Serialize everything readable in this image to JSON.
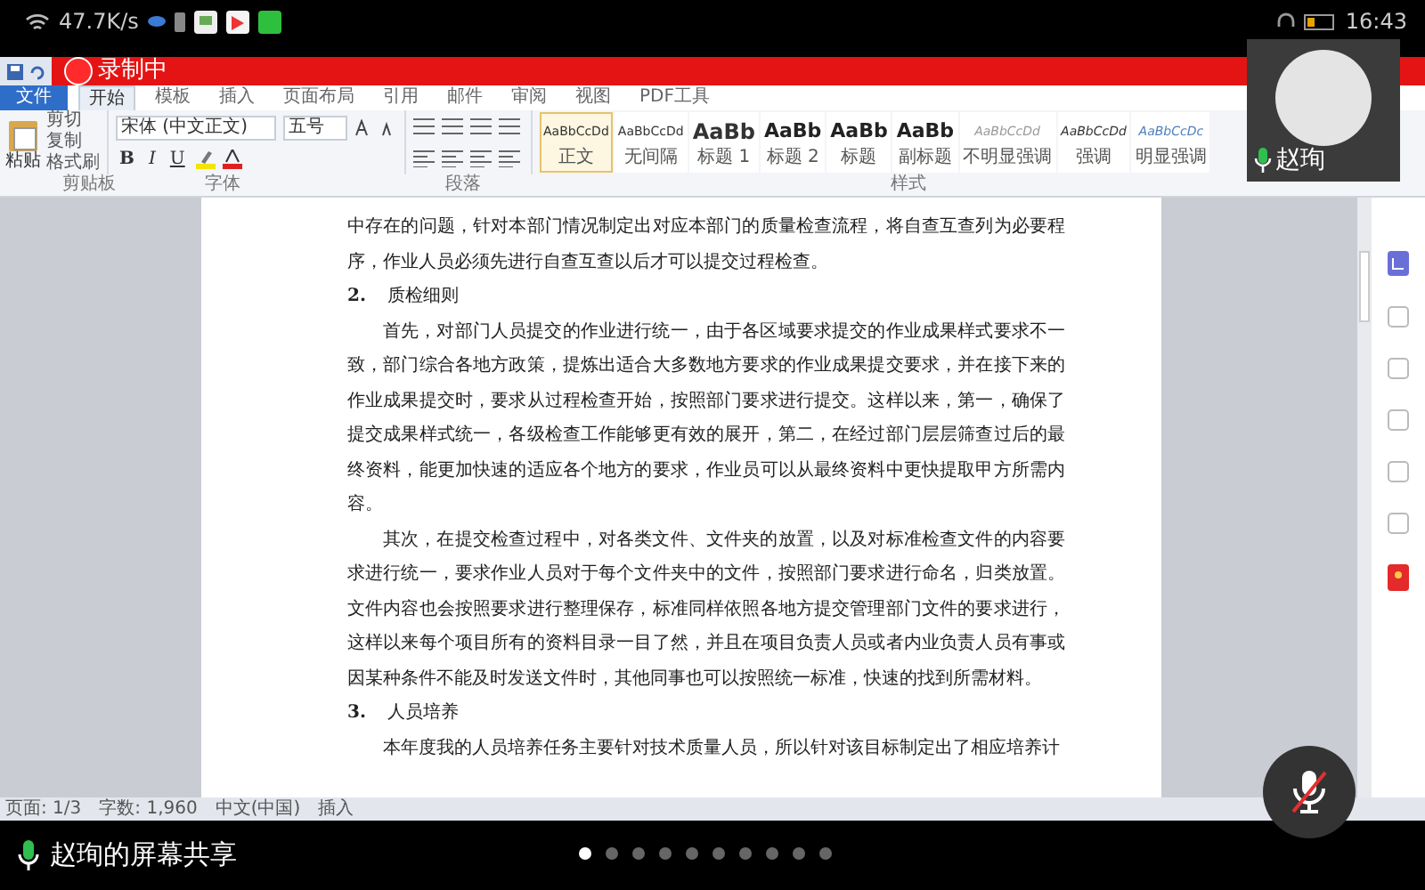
{
  "phone_status": {
    "net_speed": "47.7K/s",
    "time": "16:43"
  },
  "recording": {
    "label": "录制中"
  },
  "ribbon": {
    "tabs": [
      {
        "label": "文件",
        "kind": "file",
        "selected": false
      },
      {
        "label": "开始",
        "kind": "tab",
        "selected": true
      },
      {
        "label": "模板",
        "kind": "tab",
        "selected": false
      },
      {
        "label": "插入",
        "kind": "tab",
        "selected": false
      },
      {
        "label": "页面布局",
        "kind": "tab",
        "selected": false
      },
      {
        "label": "引用",
        "kind": "tab",
        "selected": false
      },
      {
        "label": "邮件",
        "kind": "tab",
        "selected": false
      },
      {
        "label": "审阅",
        "kind": "tab",
        "selected": false
      },
      {
        "label": "视图",
        "kind": "tab",
        "selected": false
      },
      {
        "label": "PDF工具",
        "kind": "tab",
        "selected": false
      }
    ],
    "clipboard": {
      "paste": "粘贴",
      "cut": "剪切",
      "copy": "复制",
      "format_painter": "格式刷"
    },
    "font": {
      "name": "宋体 (中文正文)",
      "size": "五号",
      "bold": "B",
      "italic": "I",
      "underline": "U"
    },
    "styles": [
      {
        "preview": "AaBbCcDd",
        "label": "正文",
        "kind": "small",
        "selected": true
      },
      {
        "preview": "AaBbCcDd",
        "label": "无间隔",
        "kind": "small",
        "selected": false
      },
      {
        "preview": "AaBb",
        "label": "标题 1",
        "kind": "large",
        "selected": false
      },
      {
        "preview": "AaBb",
        "label": "标题 2",
        "kind": "medium",
        "selected": false
      },
      {
        "preview": "AaBb",
        "label": "标题",
        "kind": "medium",
        "selected": false
      },
      {
        "preview": "AaBb",
        "label": "副标题",
        "kind": "medium",
        "selected": false
      },
      {
        "preview": "AaBbCcDd",
        "label": "不明显强调",
        "kind": "faint",
        "selected": false
      },
      {
        "preview": "AaBbCcDd",
        "label": "强调",
        "kind": "italic",
        "selected": false
      },
      {
        "preview": "AaBbCcDc",
        "label": "明显强调",
        "kind": "accent",
        "selected": false
      }
    ],
    "groups": [
      "剪贴板",
      "字体",
      "段落",
      "样式"
    ]
  },
  "document": {
    "paragraphs": [
      {
        "kind": "body",
        "indent": false,
        "text": "中存在的问题，针对本部门情况制定出对应本部门的质量检查流程，将自查互查列为必要程序，作业人员必须先进行自查互查以后才可以提交过程检查。"
      },
      {
        "kind": "heading",
        "number": "2.",
        "text": "质检细则"
      },
      {
        "kind": "body",
        "indent": true,
        "text": "首先，对部门人员提交的作业进行统一，由于各区域要求提交的作业成果样式要求不一致，部门综合各地方政策，提炼出适合大多数地方要求的作业成果提交要求，并在接下来的作业成果提交时，要求从过程检查开始，按照部门要求进行提交。这样以来，第一，确保了提交成果样式统一，各级检查工作能够更有效的展开，第二，在经过部门层层筛查过后的最终资料，能更加快速的适应各个地方的要求，作业员可以从最终资料中更快提取甲方所需内容。"
      },
      {
        "kind": "body",
        "indent": true,
        "text": "其次，在提交检查过程中，对各类文件、文件夹的放置，以及对标准检查文件的内容要求进行统一，要求作业人员对于每个文件夹中的文件，按照部门要求进行命名，归类放置。文件内容也会按照要求进行整理保存，标准同样依照各地方提交管理部门文件的要求进行，这样以来每个项目所有的资料目录一目了然，并且在项目负责人员或者内业负责人员有事或因某种条件不能及时发送文件时，其他同事也可以按照统一标准，快速的找到所需材料。"
      },
      {
        "kind": "heading",
        "number": "3.",
        "text": "人员培养"
      },
      {
        "kind": "body",
        "indent": true,
        "text": "本年度我的人员培养任务主要针对技术质量人员，所以针对该目标制定出了相应培养计"
      }
    ]
  },
  "word_status": [
    "页面: 1/3",
    "字数: 1,960",
    "中文(中国)",
    "插入"
  ],
  "participant": {
    "name": "赵珣"
  },
  "mic_button": {
    "muted": true
  },
  "share": {
    "label": "赵珣的屏幕共享"
  },
  "pages": [
    {
      "selected": true
    },
    {
      "selected": false
    },
    {
      "selected": false
    },
    {
      "selected": false
    },
    {
      "selected": false
    },
    {
      "selected": false
    },
    {
      "selected": false
    },
    {
      "selected": false
    },
    {
      "selected": false
    },
    {
      "selected": false
    }
  ]
}
